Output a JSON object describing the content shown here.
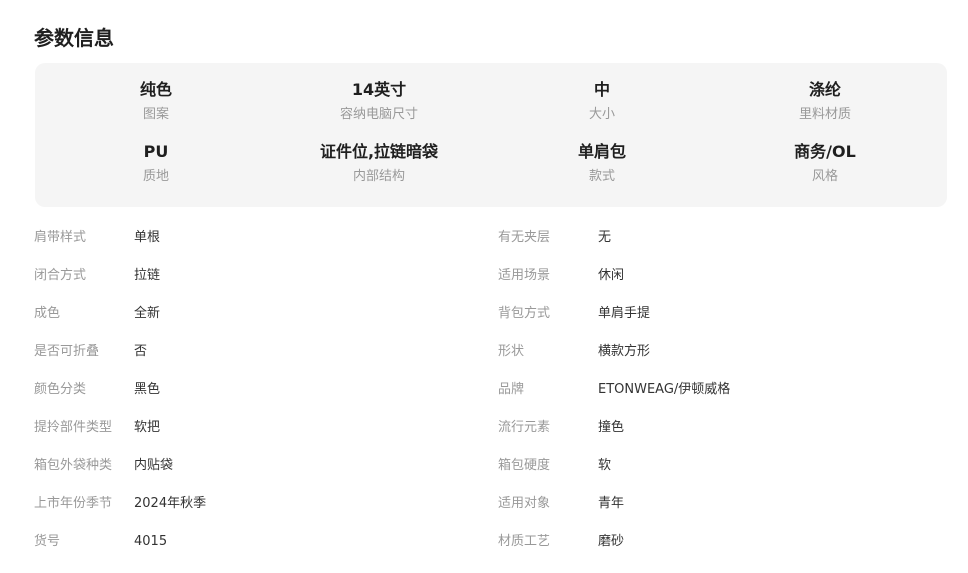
{
  "section_title": "参数信息",
  "highlights": [
    {
      "value": "纯色",
      "label": "图案"
    },
    {
      "value": "14英寸",
      "label": "容纳电脑尺寸"
    },
    {
      "value": "中",
      "label": "大小"
    },
    {
      "value": "涤纶",
      "label": "里料材质"
    },
    {
      "value": "PU",
      "label": "质地"
    },
    {
      "value": "证件位,拉链暗袋",
      "label": "内部结构"
    },
    {
      "value": "单肩包",
      "label": "款式"
    },
    {
      "value": "商务/OL",
      "label": "风格"
    }
  ],
  "attributes_left": [
    {
      "key": "肩带样式",
      "value": "单根"
    },
    {
      "key": "闭合方式",
      "value": "拉链"
    },
    {
      "key": "成色",
      "value": "全新"
    },
    {
      "key": "是否可折叠",
      "value": "否"
    },
    {
      "key": "颜色分类",
      "value": "黑色"
    },
    {
      "key": "提拎部件类型",
      "value": "软把"
    },
    {
      "key": "箱包外袋种类",
      "value": "内贴袋"
    },
    {
      "key": "上市年份季节",
      "value": "2024年秋季"
    },
    {
      "key": "货号",
      "value": "4015"
    }
  ],
  "attributes_right": [
    {
      "key": "有无夹层",
      "value": "无"
    },
    {
      "key": "适用场景",
      "value": "休闲"
    },
    {
      "key": "背包方式",
      "value": "单肩手提"
    },
    {
      "key": "形状",
      "value": "横款方形"
    },
    {
      "key": "品牌",
      "value": "ETONWEAG/伊顿威格"
    },
    {
      "key": "流行元素",
      "value": "撞色"
    },
    {
      "key": "箱包硬度",
      "value": "软"
    },
    {
      "key": "适用对象",
      "value": "青年"
    },
    {
      "key": "材质工艺",
      "value": "磨砂"
    }
  ]
}
